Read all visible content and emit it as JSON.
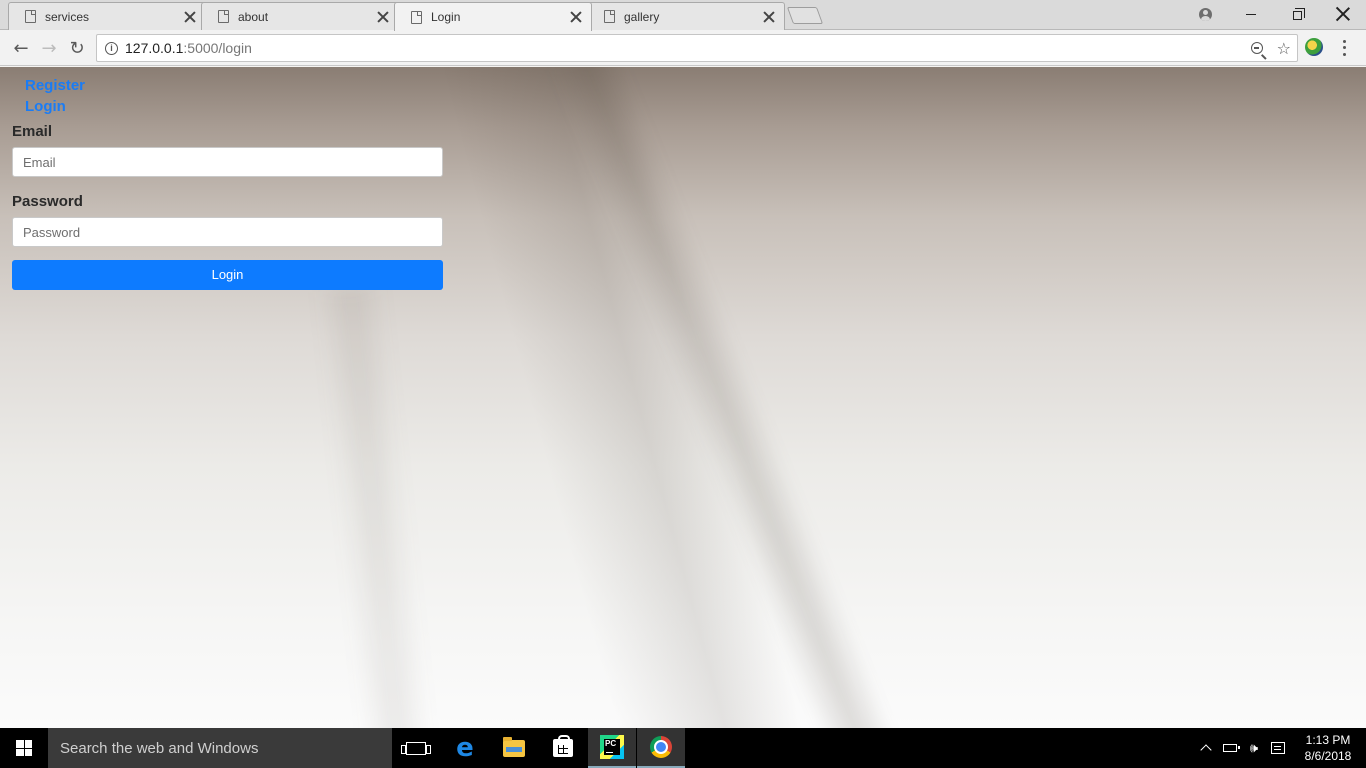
{
  "browser": {
    "tabs": [
      {
        "title": "services",
        "active": false
      },
      {
        "title": "about",
        "active": false
      },
      {
        "title": "Login",
        "active": true
      },
      {
        "title": "gallery",
        "active": false
      }
    ],
    "url_host": "127.0.0.1",
    "url_path": ":5000/login",
    "icons": {
      "back": "back-arrow-icon",
      "forward": "forward-arrow-icon",
      "reload": "reload-icon",
      "info": "info-icon",
      "zoom": "zoom-icon",
      "bookmark": "star-icon",
      "extension": "extension-icon",
      "menu": "menu-icon"
    }
  },
  "page": {
    "nav_links": [
      {
        "label": "Register"
      },
      {
        "label": "Login"
      }
    ],
    "form": {
      "email_label": "Email",
      "email_placeholder": "Email",
      "email_value": "",
      "password_label": "Password",
      "password_placeholder": "Password",
      "password_value": "",
      "submit_label": "Login"
    },
    "colors": {
      "link": "#1a7cf5",
      "button": "#0d7bff"
    }
  },
  "taskbar": {
    "search_placeholder": "Search the web and Windows",
    "apps": [
      "task-view",
      "edge",
      "file-explorer",
      "store",
      "pycharm",
      "chrome"
    ],
    "clock_time": "1:13 PM",
    "clock_date": "8/6/2018"
  }
}
